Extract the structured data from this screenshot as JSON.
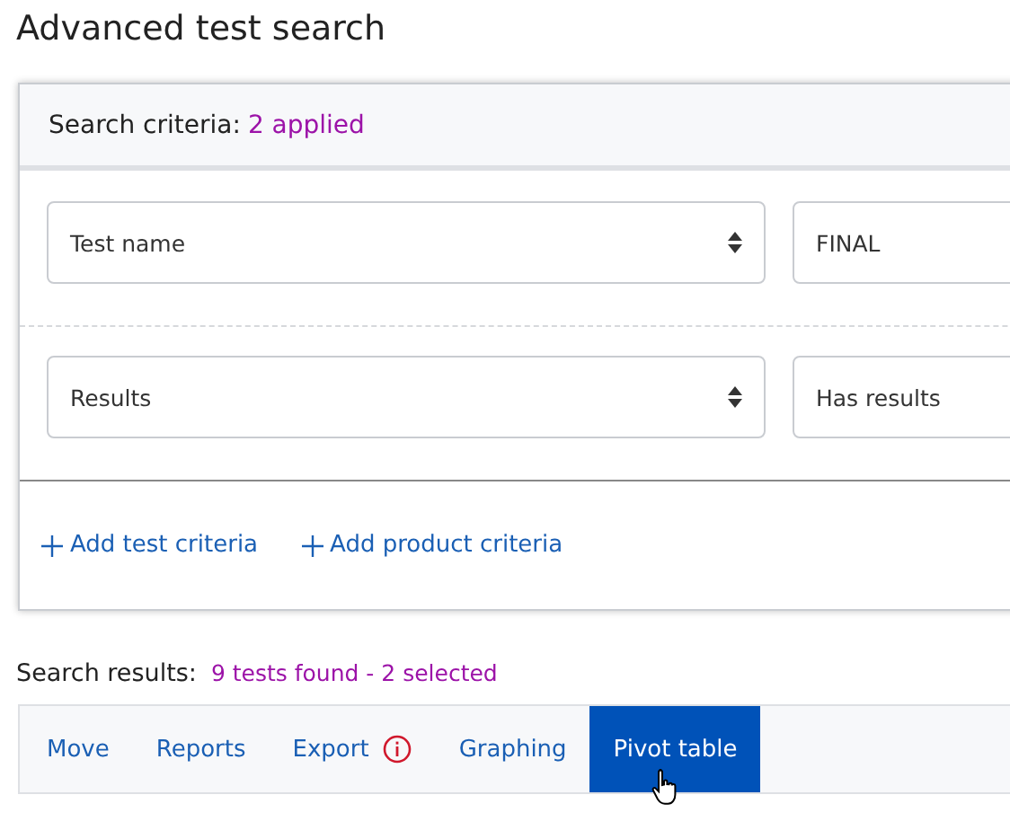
{
  "page": {
    "title": "Advanced test search"
  },
  "criteria": {
    "label": "Search criteria:",
    "count": "2 applied",
    "rows": [
      {
        "field": "Test name",
        "value": "FINAL"
      },
      {
        "field": "Results",
        "value": "Has results"
      }
    ],
    "links": [
      {
        "label": "Add test criteria"
      },
      {
        "label": "Add product criteria"
      }
    ]
  },
  "results": {
    "label": "Search results:",
    "summary": "9 tests found - 2 selected"
  },
  "toolbar": [
    {
      "label": "Move",
      "selected": false,
      "alert": false
    },
    {
      "label": "Reports",
      "selected": false,
      "alert": false
    },
    {
      "label": "Export",
      "selected": false,
      "alert": true
    },
    {
      "label": "Graphing",
      "selected": false,
      "alert": false
    },
    {
      "label": "Pivot table",
      "selected": true,
      "alert": false
    }
  ]
}
